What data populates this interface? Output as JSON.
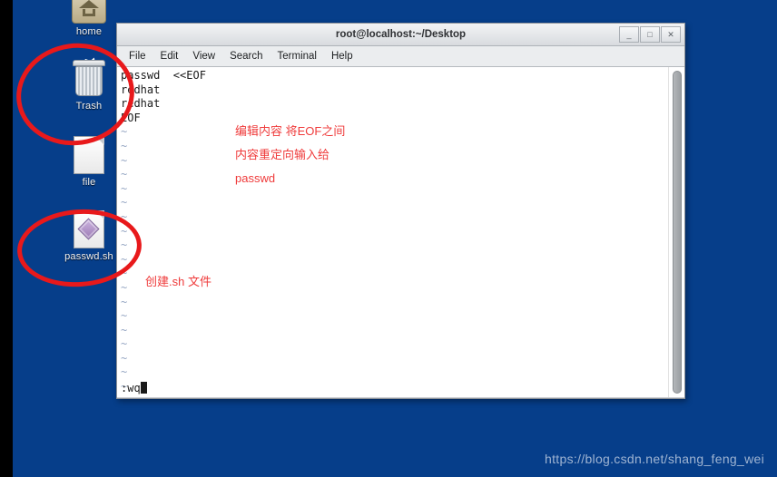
{
  "desktop": {
    "background_color": "#063e8a",
    "icons": [
      {
        "name": "home",
        "label": "home",
        "icon": "home-folder-icon"
      },
      {
        "name": "trash",
        "label": "Trash",
        "icon": "trash-bin-icon"
      },
      {
        "name": "file",
        "label": "file",
        "icon": "document-icon"
      },
      {
        "name": "passwd-sh",
        "label": "passwd.sh",
        "icon": "script-document-icon"
      }
    ]
  },
  "terminal": {
    "title": "root@localhost:~/Desktop",
    "window_buttons": [
      {
        "name": "minimize",
        "glyph": "_"
      },
      {
        "name": "maximize",
        "glyph": "□"
      },
      {
        "name": "close",
        "glyph": "✕"
      }
    ],
    "menu": [
      "File",
      "Edit",
      "View",
      "Search",
      "Terminal",
      "Help"
    ],
    "editor": {
      "lines": [
        "passwd  <<EOF",
        "redhat",
        "redhat",
        "EOF"
      ],
      "empty_marker": "~",
      "empty_marker_count": 19,
      "status_line": ":wq",
      "tilde_color": "#97a8c4"
    }
  },
  "annotations": {
    "color": "#ef3b3b",
    "ellipse_color": "#e8191b",
    "texts": [
      {
        "name": "annotation-heredoc",
        "lines": [
          "编辑内容 将EOF之间",
          "内容重定向输入给",
          "passwd"
        ]
      },
      {
        "name": "annotation-create-sh",
        "lines": [
          "创建.sh 文件"
        ]
      }
    ],
    "ellipses": [
      {
        "name": "ellipse-heredoc-block"
      },
      {
        "name": "ellipse-passwd-sh-icon"
      }
    ]
  },
  "watermark": {
    "text": "https://blog.csdn.net/shang_feng_wei"
  }
}
